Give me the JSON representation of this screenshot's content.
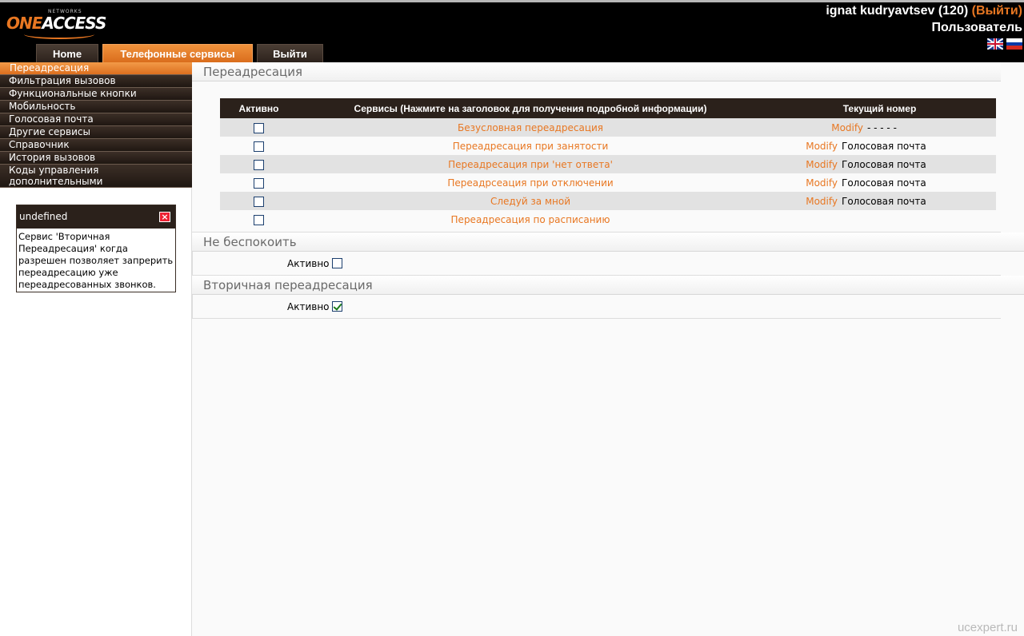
{
  "header": {
    "logo": {
      "one": "ONE",
      "access": "ACCESS",
      "networks": "NETWORKS"
    },
    "user": {
      "name": "ignat kudryavtsev (120) ",
      "open_paren": "(",
      "logout": "Выйти",
      "close_paren": ")"
    },
    "role": "Пользователь",
    "flags": [
      "uk-flag-icon",
      "ru-flag-icon"
    ]
  },
  "tabs": [
    {
      "label": "Home",
      "active": false
    },
    {
      "label": "Телефонные сервисы",
      "active": true
    },
    {
      "label": "Выйти",
      "active": false
    }
  ],
  "sidebar": {
    "items": [
      {
        "label": "Переадресация",
        "active": true
      },
      {
        "label": "Фильтрация вызовов"
      },
      {
        "label": "Функциональные кнопки"
      },
      {
        "label": "Мобильность"
      },
      {
        "label": "Голосовая почта"
      },
      {
        "label": "Другие сервисы"
      },
      {
        "label": "Справочник"
      },
      {
        "label": "История вызовов"
      },
      {
        "label": "Коды управления дополнительными",
        "label2": "услугами"
      }
    ]
  },
  "help_box": {
    "title": "undefined",
    "text": "Сервис 'Вторичная Переадресация' когда разрешен позволяет запрерить переадресацию уже переадресованных звонков."
  },
  "forwarding": {
    "title": "Переадресация",
    "columns": {
      "active": "Активно",
      "services": "Сервисы (Нажмите на заголовок для получения подробной информации)",
      "current": "Текущий номер"
    },
    "rows": [
      {
        "service": "Безусловная переадресация",
        "modify": "Modify",
        "value": "- - - - -",
        "checked": false
      },
      {
        "service": "Переадресация при занятости",
        "modify": "Modify",
        "value": "Голосовая почта",
        "checked": false
      },
      {
        "service": "Переадресация при 'нет ответа'",
        "modify": "Modify",
        "value": "Голосовая почта",
        "checked": false
      },
      {
        "service": "Переадрсеация при отключении",
        "modify": "Modify",
        "value": "Голосовая почта",
        "checked": false
      },
      {
        "service": "Следуй за мной",
        "modify": "Modify",
        "value": "Голосовая почта",
        "checked": false
      },
      {
        "service": "Переадресация по расписанию",
        "modify": "",
        "value": "",
        "checked": false
      }
    ]
  },
  "dnd": {
    "title": "Не беспокоить",
    "label": "Активно",
    "checked": false
  },
  "secondary": {
    "title": "Вторичная переадресация",
    "label": "Активно",
    "checked": true
  },
  "credit": "ucexpert.ru",
  "colors": {
    "accent": "#e87722",
    "dark": "#2b211b",
    "row_alt": "#e2e2e2"
  }
}
